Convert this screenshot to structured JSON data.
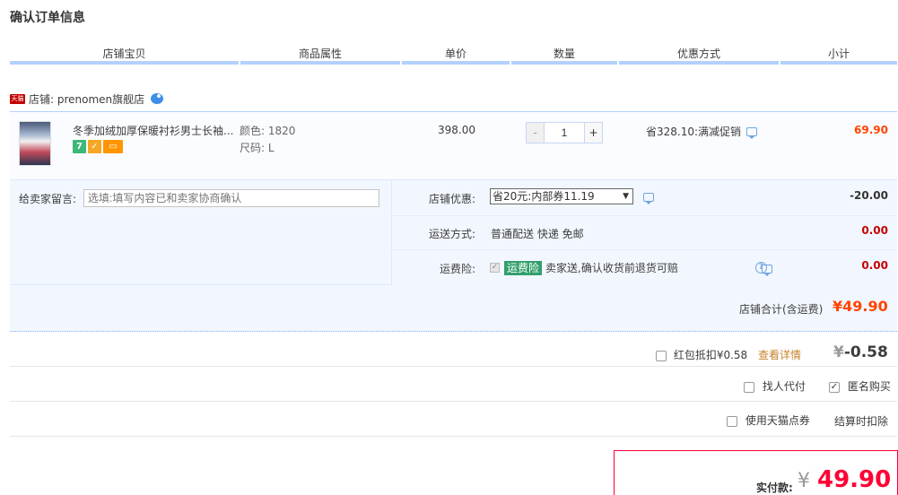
{
  "page_title": "确认订单信息",
  "columns": [
    "店铺宝贝",
    "商品属性",
    "单价",
    "数量",
    "优惠方式",
    "小计"
  ],
  "shop": {
    "badge": "天猫",
    "name": "店铺: prenomen旗舰店"
  },
  "item": {
    "title": "冬季加绒加厚保暖衬衫男士长袖...",
    "badges": [
      "7",
      "✓",
      "▭"
    ],
    "color": "颜色: 1820",
    "size": "尺码: L",
    "price": "398.00",
    "qty_minus": "-",
    "qty": "1",
    "qty_plus": "+",
    "promo": "省328.10:满减促销",
    "subtotal": "69.90"
  },
  "memo": {
    "label": "给卖家留言:",
    "placeholder": "选填:填写内容已和卖家协商确认"
  },
  "shop_discount": {
    "label": "店铺优惠:",
    "selected": "省20元:内部券11.19",
    "arrow": "▼",
    "value": "-20.00"
  },
  "shipping": {
    "label": "运送方式:",
    "value": "普通配送 快递 免邮",
    "cost": "0.00"
  },
  "insurance": {
    "label": "运费险:",
    "tag": "运费险",
    "desc": "卖家送,确认收货前退货可赔",
    "cost": "0.00",
    "help": "?"
  },
  "shop_total": {
    "label": "店铺合计(含运费)",
    "value": "¥49.90"
  },
  "redpacket": {
    "label": "红包抵扣¥0.58",
    "link": "查看详情",
    "yen": "¥",
    "value": "-0.58"
  },
  "options": {
    "pay_for_me": "找人代付",
    "anonymous": "匿名购买",
    "tmall_points": "使用天猫点券",
    "points_note": "结算时扣除"
  },
  "final": {
    "label": "实付款:",
    "yen": "¥",
    "value": "49.90"
  },
  "colors": {
    "accent_red": "#ff0036",
    "orange_red": "#ff4400",
    "header_line": "#b2d1ff",
    "panel_bg": "#f2f7ff"
  }
}
